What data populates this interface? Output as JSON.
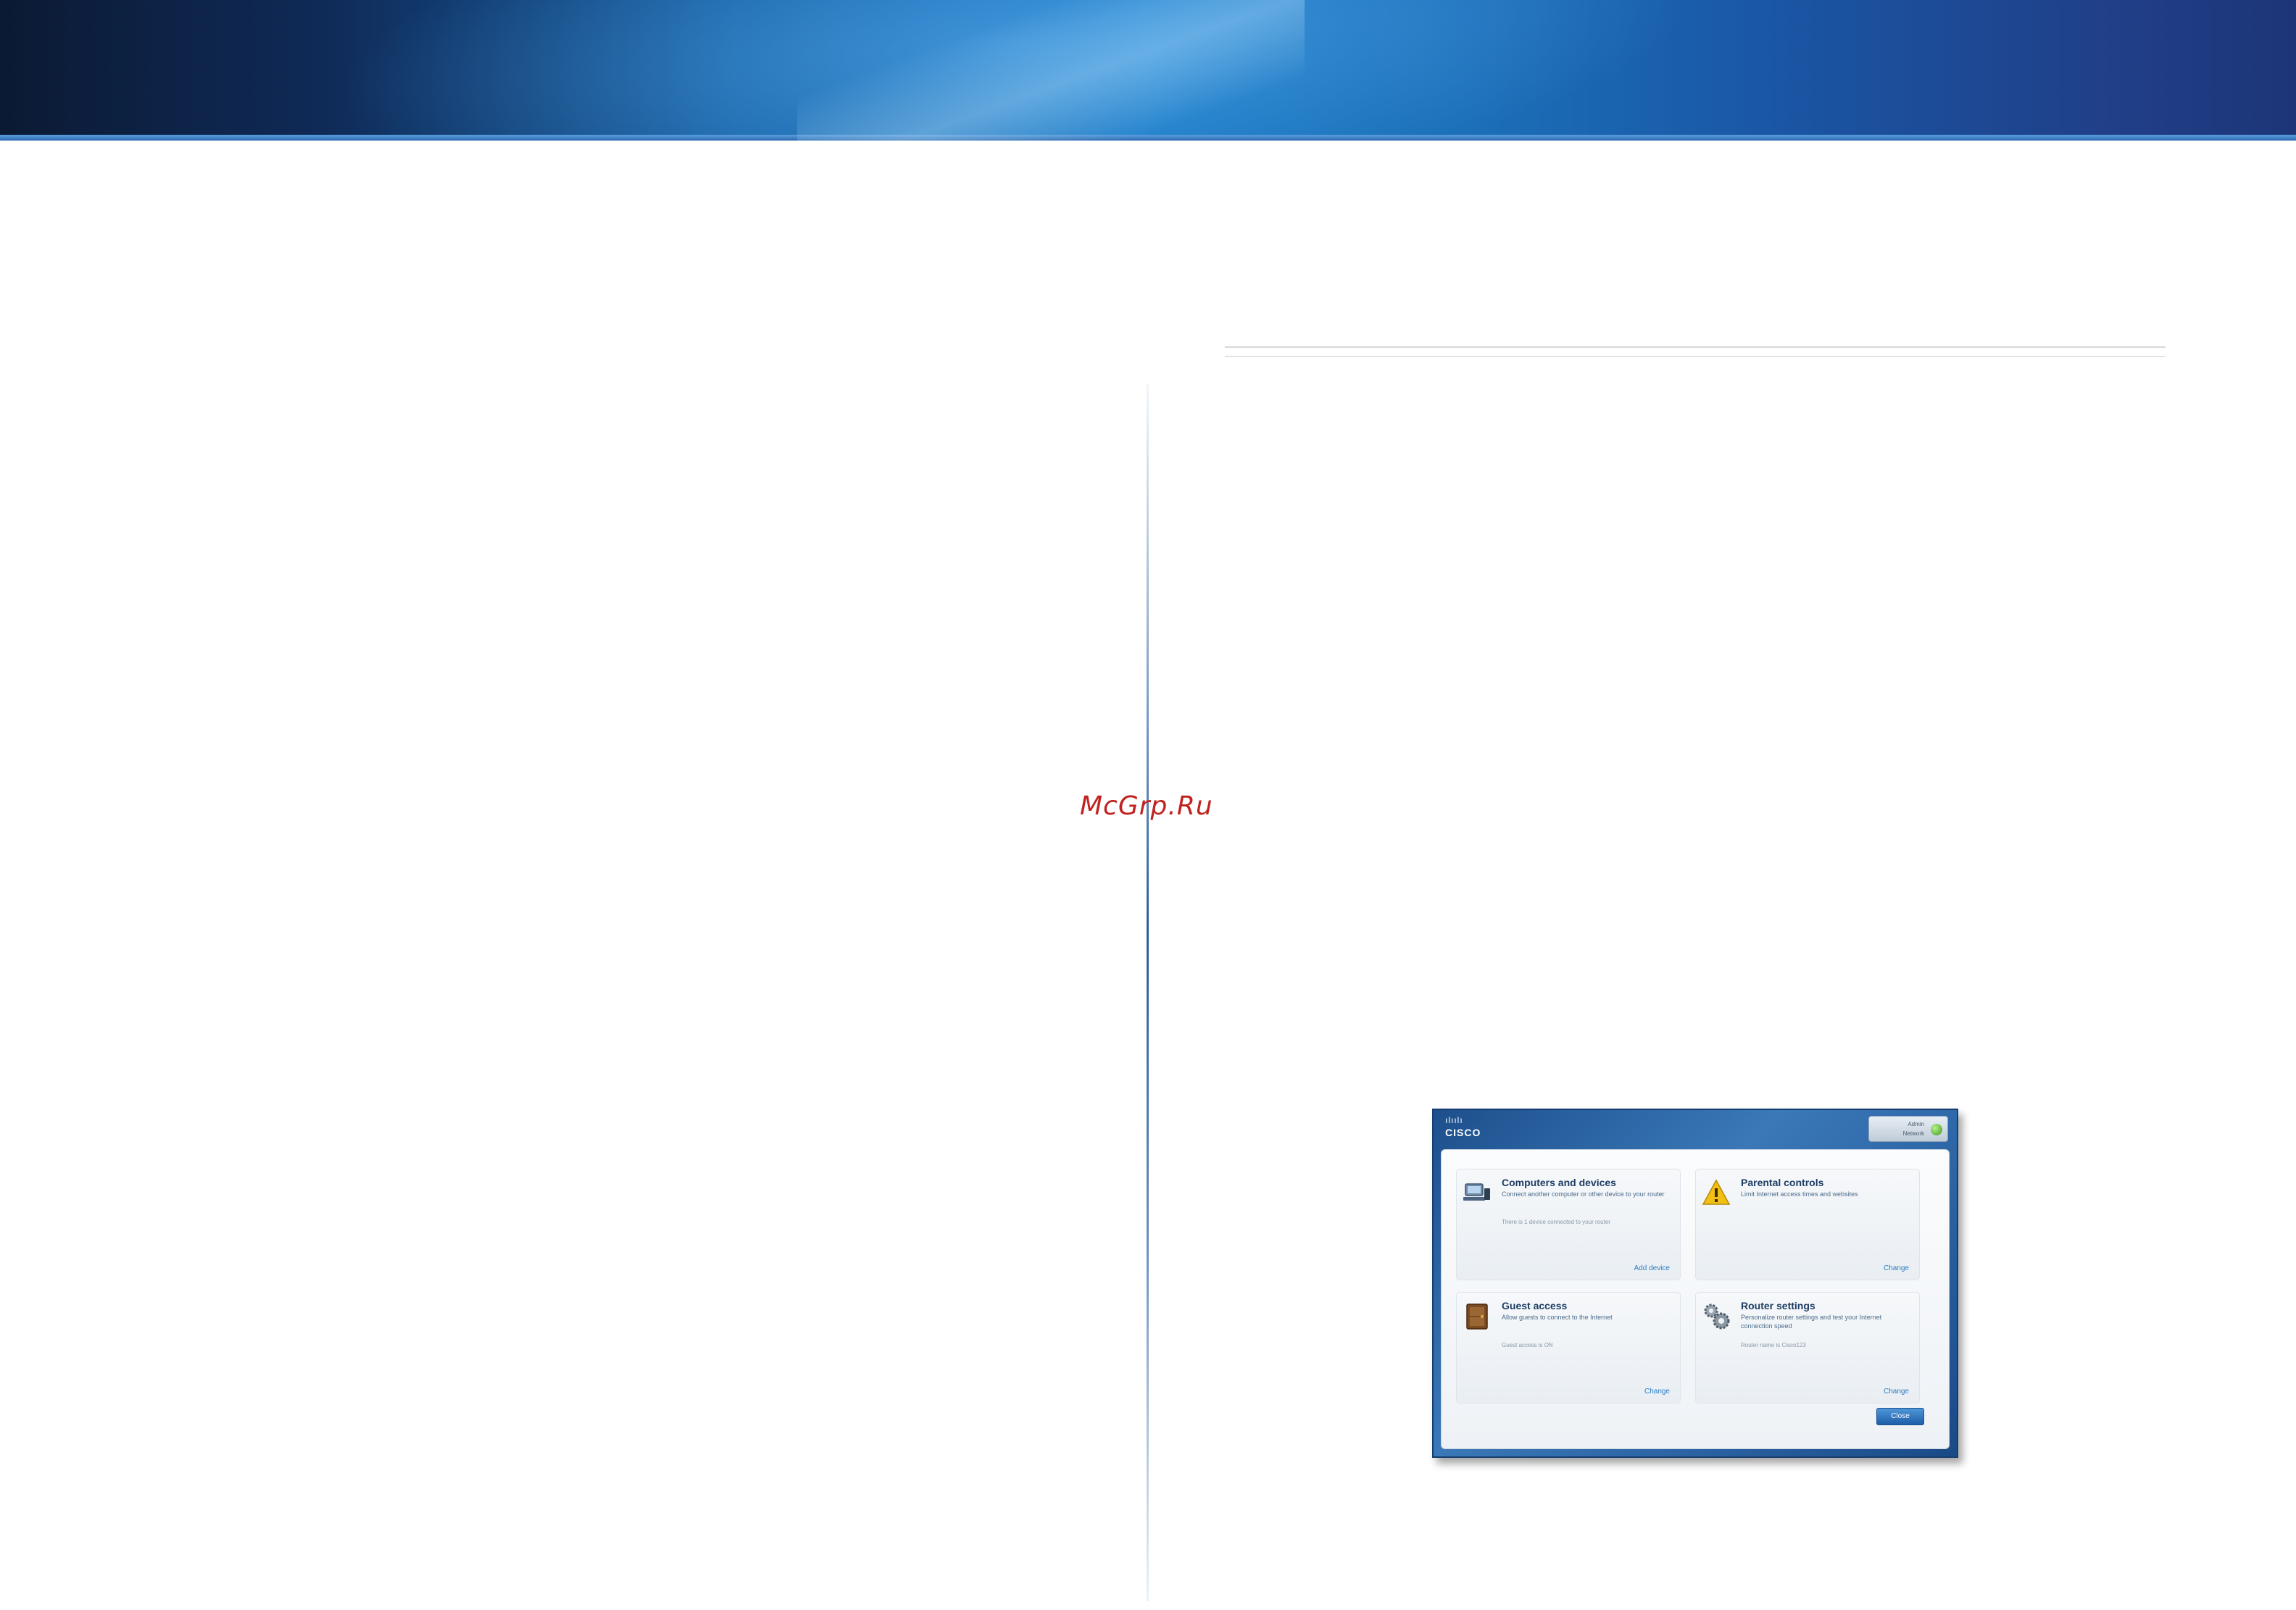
{
  "watermark": "McGrp.Ru",
  "screenshot": {
    "logo_bars": "ılıılı",
    "logo_text": "CISCO",
    "user_label_line1": "Admin",
    "user_label_line2": "Network",
    "tiles": [
      {
        "title": "Computers and devices",
        "description": "Connect another computer or other device to your router",
        "note": "There is 1 device connected to your router",
        "link": "Add device",
        "icon": "computer-devices-icon"
      },
      {
        "title": "Parental controls",
        "description": "Limit Internet access times and websites",
        "note": "",
        "link": "Change",
        "icon": "warning-icon"
      },
      {
        "title": "Guest access",
        "description": "Allow guests to connect to the Internet",
        "note": "Guest access is ON",
        "link": "Change",
        "icon": "guest-access-icon"
      },
      {
        "title": "Router settings",
        "description": "Personalize router settings and test your Internet connection speed",
        "note": "Router name is Cisco123",
        "link": "Change",
        "icon": "gears-icon"
      }
    ],
    "close_label": "Close"
  }
}
